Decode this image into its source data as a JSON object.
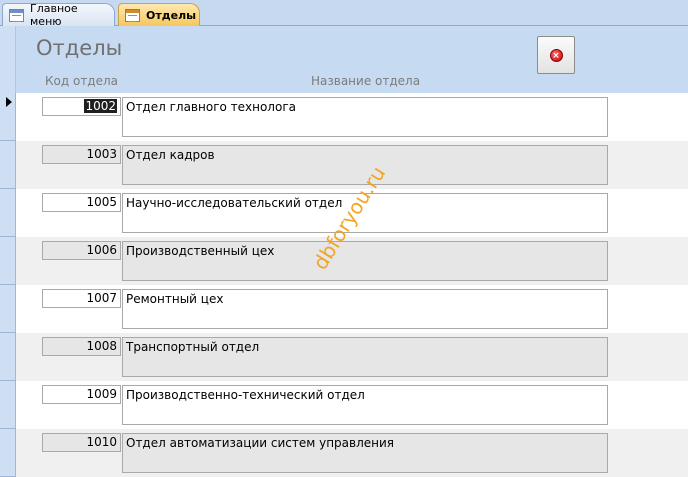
{
  "tabs": [
    {
      "label": "Главное меню",
      "icon": "form-icon",
      "active": false
    },
    {
      "label": "Отделы",
      "icon": "form-icon",
      "active": true
    }
  ],
  "header": {
    "title": "Отделы",
    "columns": {
      "code": "Код отдела",
      "name": "Название отдела"
    },
    "close_button_icon": "close-circle-icon"
  },
  "records": [
    {
      "code": "1002",
      "name": "Отдел главного технолога",
      "current": true
    },
    {
      "code": "1003",
      "name": "Отдел кадров"
    },
    {
      "code": "1005",
      "name": "Научно-исследовательский отдел"
    },
    {
      "code": "1006",
      "name": "Производственный цех"
    },
    {
      "code": "1007",
      "name": "Ремонтный цех"
    },
    {
      "code": "1008",
      "name": "Транспортный отдел"
    },
    {
      "code": "1009",
      "name": "Производственно-технический отдел"
    },
    {
      "code": "1010",
      "name": "Отдел автоматизации систем управления"
    }
  ],
  "watermark": "dbforyou.ru",
  "colors": {
    "header_bg": "#c6daf1",
    "active_tab": "#f7c65c",
    "alt_row": "#f0f0f0",
    "watermark": "#f2a21c"
  }
}
